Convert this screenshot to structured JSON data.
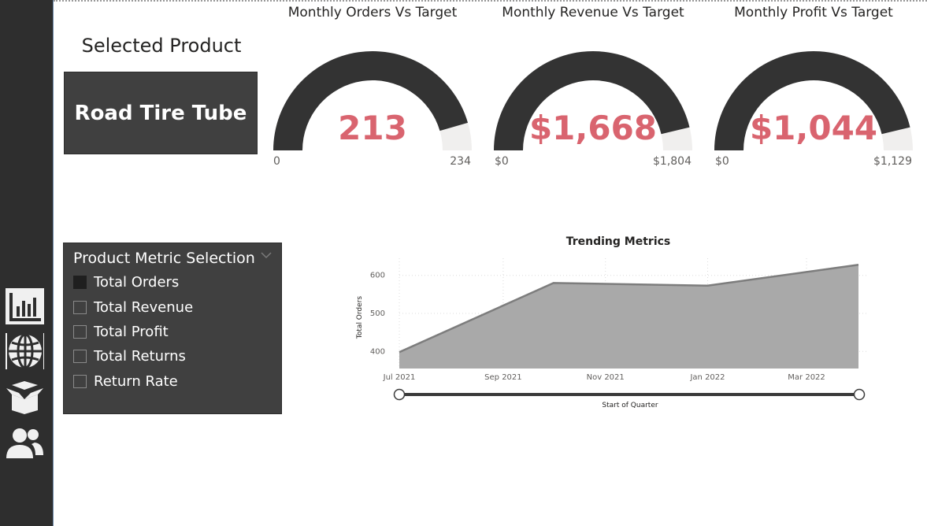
{
  "sidebar": {
    "items": [
      {
        "icon": "bar-chart-icon"
      },
      {
        "icon": "globe-icon"
      },
      {
        "icon": "open-box-icon"
      },
      {
        "icon": "users-icon"
      }
    ]
  },
  "selected_product": {
    "title": "Selected Product",
    "value": "Road Tire Tube"
  },
  "gauges": [
    {
      "title": "Monthly Orders Vs Target",
      "value": "213",
      "min": "0",
      "max": "234",
      "fill": 0.91
    },
    {
      "title": "Monthly Revenue Vs Target",
      "value": "$1,668",
      "min": "$0",
      "max": "$1,804",
      "fill": 0.925
    },
    {
      "title": "Monthly Profit Vs Target",
      "value": "$1,044",
      "min": "$0",
      "max": "$1,129",
      "fill": 0.925
    }
  ],
  "slicer": {
    "title": "Product Metric Selection",
    "items": [
      {
        "label": "Total Orders",
        "checked": true
      },
      {
        "label": "Total Revenue",
        "checked": false
      },
      {
        "label": "Total Profit",
        "checked": false
      },
      {
        "label": "Total Returns",
        "checked": false
      },
      {
        "label": "Return Rate",
        "checked": false
      }
    ]
  },
  "colors": {
    "accent": "#d9646f",
    "gauge_fill": "#333333",
    "gauge_track": "#f0efee",
    "panel": "#404040",
    "area": "#a9a9a9"
  },
  "chart_data": {
    "type": "area",
    "title": "Trending Metrics",
    "xlabel": "Start of Quarter",
    "ylabel": "Total Orders",
    "x": [
      "2021-07-01",
      "2021-10-01",
      "2022-01-01",
      "2022-04-01"
    ],
    "values": [
      398,
      580,
      573,
      628
    ],
    "x_ticks": [
      "Jul 2021",
      "Sep 2021",
      "Nov 2021",
      "Jan 2022",
      "Mar 2022"
    ],
    "y_ticks": [
      400,
      500,
      600
    ],
    "ylim": [
      355,
      645
    ],
    "grid": true
  }
}
